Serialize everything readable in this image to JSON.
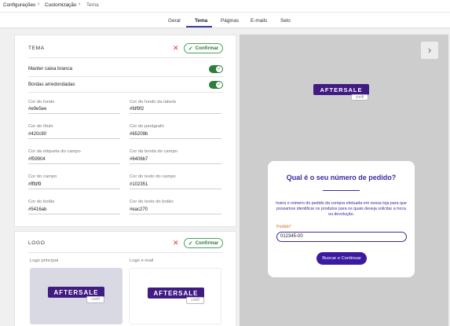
{
  "breadcrumb": {
    "items": [
      "Configurações",
      "Customização",
      "Tema"
    ]
  },
  "tabs": [
    "Geral",
    "Tema",
    "Páginas",
    "E-mails",
    "Selo"
  ],
  "active_tab": "Tema",
  "theme_card": {
    "title": "TEMA",
    "confirm_label": "Confirmar",
    "toggles": [
      {
        "label": "Manter caixa branca",
        "on": true
      },
      {
        "label": "Bordas arredondadas",
        "on": true
      }
    ],
    "fields": [
      {
        "label": "Cor do fundo",
        "value": "#e9e5ee"
      },
      {
        "label": "Cor do fundo da tabela",
        "value": "#fdf9f2"
      },
      {
        "label": "Cor do título",
        "value": "#420c90"
      },
      {
        "label": "Cor do parágrafo",
        "value": "#65209b"
      },
      {
        "label": "Cor da etiqueta do campo",
        "value": "#f59904"
      },
      {
        "label": "Cor da borda do campo",
        "value": "#6406b7"
      },
      {
        "label": "Cor do campo",
        "value": "#fffdf9"
      },
      {
        "label": "Cor do texto do campo",
        "value": "#102351"
      },
      {
        "label": "Cor do botão",
        "value": "#5416ab"
      },
      {
        "label": "Cor do texto do botão",
        "value": "#eac270"
      }
    ]
  },
  "logo_card": {
    "title": "LOGO",
    "confirm_label": "Confirmar",
    "main_label": "Logo principal",
    "email_label": "Logo e-mail"
  },
  "brand": {
    "name": "AFTERSALE",
    "sub": "confi"
  },
  "preview": {
    "title": "Qual é o seu número de pedido?",
    "description": "Insira o número do pedido da compra efetuada em nossa loja para que possamos identificar os produtos para os quais deseja solicitar a troca ou devolução.",
    "input_label": "Pedido*",
    "input_value": "012345-00",
    "button_label": "Buscar e Continuar"
  },
  "icons": {
    "close": "close-icon",
    "check": "check-icon",
    "chevron": "chevron-right-icon"
  },
  "colors": {
    "accent": "#3e3e9a",
    "success": "#2e7d3f",
    "danger": "#d33333",
    "brand": "#3f1b82"
  }
}
